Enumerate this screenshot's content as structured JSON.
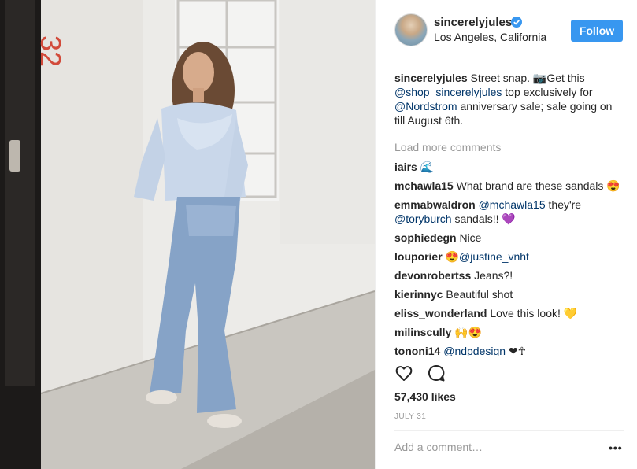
{
  "post": {
    "username": "sincerelyjules",
    "location": "Los Angeles, California",
    "follow_label": "Follow",
    "caption": {
      "username": "sincerelyjules",
      "text_1": "Street snap. 📷Get this",
      "mention_1": "@shop_sincerelyjules",
      "text_2": " top exclusively for",
      "mention_2": "@Nordstrom",
      "text_3": " anniversary sale; sale going on till August 6th."
    },
    "load_more": "Load more comments",
    "comments": [
      {
        "user": "iairs",
        "text": "🌊"
      },
      {
        "user": "mchawla15",
        "text": "What brand are these sandals 😍"
      },
      {
        "user": "emmabwaldron",
        "mention": "@mchawla15",
        "text": " they're ",
        "mention_2": "@toryburch",
        "text_2": " sandals!! 💜"
      },
      {
        "user": "sophiedegn",
        "text": "Nice"
      },
      {
        "user": "louporier",
        "text": "😍",
        "mention": "@justine_vnht"
      },
      {
        "user": "devonrobertss",
        "text": "Jeans?!"
      },
      {
        "user": "kierinnyc",
        "text": "Beautiful shot"
      },
      {
        "user": "eliss_wonderland",
        "text": "Love this look! 💛"
      },
      {
        "user": "milinscully",
        "text": "🙌😍"
      },
      {
        "user": "tononi14",
        "mention": "@ndpdesign",
        "text": " ❤☥"
      }
    ],
    "likes": "57,430 likes",
    "date": "JULY 31",
    "add_comment_placeholder": "Add a comment…",
    "more_label": "•••",
    "icons": {
      "like": "heart-icon",
      "comment": "comment-icon",
      "verified": "verified-badge-icon",
      "more": "more-options-icon"
    },
    "colors": {
      "accent": "#3897f0",
      "link": "#003569",
      "muted": "#999999",
      "text": "#262626"
    },
    "photo_text": "32"
  }
}
